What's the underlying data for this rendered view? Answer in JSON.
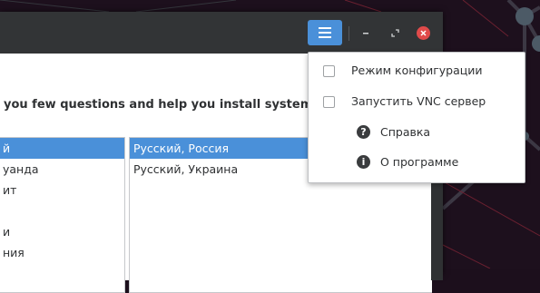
{
  "window": {
    "intro_text": "you few questions and help you install system on your c"
  },
  "titlebar": {
    "menu_button_icon": "hamburger-menu-icon",
    "minimize_icon": "minimize-icon",
    "maximize_icon": "maximize-icon",
    "close_icon": "close-icon",
    "accent_color": "#4a90d9",
    "close_color": "#e04a4a"
  },
  "language_list": {
    "items": [
      {
        "label": "й",
        "selected": true
      },
      {
        "label": "уанда",
        "selected": false
      },
      {
        "label": "ит",
        "selected": false
      },
      {
        "label": "",
        "selected": false
      },
      {
        "label": "и",
        "selected": false
      },
      {
        "label": "ния",
        "selected": false
      }
    ]
  },
  "locale_list": {
    "items": [
      {
        "label": "Русский, Россия",
        "selected": true
      },
      {
        "label": "Русский, Украина",
        "selected": false
      }
    ]
  },
  "popup_menu": {
    "items": [
      {
        "label": "Режим конфигурации",
        "type": "checkbox",
        "checked": false
      },
      {
        "label": "Запустить VNC сервер",
        "type": "checkbox",
        "checked": false
      },
      {
        "label": "Справка",
        "type": "action",
        "icon": "help-icon",
        "glyph": "?"
      },
      {
        "label": "О программе",
        "type": "action",
        "icon": "info-icon",
        "glyph": "i"
      }
    ]
  }
}
